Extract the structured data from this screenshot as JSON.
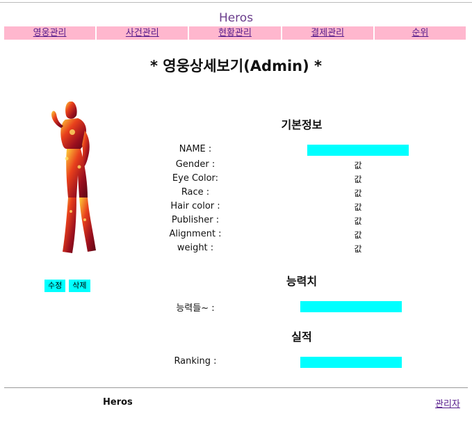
{
  "header": {
    "title": "Heros",
    "nav": [
      "영웅관리",
      "사건관리",
      "현황관리",
      "결제관리",
      "순위"
    ]
  },
  "page": {
    "heading": "* 영웅상세보기(Admin) *"
  },
  "hero": {
    "image": "iron-man-figure"
  },
  "actions": {
    "edit": "수정",
    "delete": "삭제"
  },
  "basic_info": {
    "title": "기본정보",
    "fields": [
      {
        "label": "NAME :",
        "value": ""
      },
      {
        "label": "Gender :",
        "value": "값"
      },
      {
        "label": "Eye Color:",
        "value": "값"
      },
      {
        "label": "Race :",
        "value": "값"
      },
      {
        "label": "Hair color :",
        "value": "값"
      },
      {
        "label": "Publisher :",
        "value": "값"
      },
      {
        "label": "Alignment :",
        "value": "값"
      },
      {
        "label": "weight :",
        "value": "값"
      }
    ]
  },
  "abilities": {
    "title": "능력치",
    "label": "능력들~ :"
  },
  "performance": {
    "title": "실적",
    "label": "Ranking :"
  },
  "footer": {
    "brand": "Heros",
    "admin_link": "관리자"
  },
  "colors": {
    "nav_bg": "#ffb7ce",
    "highlight": "#00ffff",
    "title": "#6a3d8c"
  }
}
